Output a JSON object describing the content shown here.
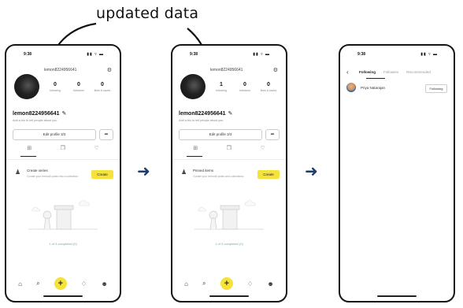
{
  "annotation": {
    "label": "updated data"
  },
  "phone1": {
    "status_time": "9:38",
    "status_icons": "▮▮ ▿ ▬",
    "top_username": "lemon8224956641",
    "stats": [
      {
        "value": "0",
        "label": "following"
      },
      {
        "value": "0",
        "label": "followers"
      },
      {
        "value": "0",
        "label": "likes & saves"
      }
    ],
    "username": "lemon8224956641",
    "bio": "Add a bio to tell people about you",
    "edit_profile": "Edit profile 3/3",
    "card_title": "Create series",
    "card_sub": "Curate your lemon8 posts into a collection",
    "create_label": "Create",
    "completed": "1 of 3 completed (0)"
  },
  "phone2": {
    "status_time": "9:38",
    "status_icons": "▮▮ ▿ ▬",
    "top_username": "lemon8224956641",
    "stats": [
      {
        "value": "1",
        "label": "following"
      },
      {
        "value": "0",
        "label": "followers"
      },
      {
        "value": "0",
        "label": "likes & saves"
      }
    ],
    "username": "lemon8224956641",
    "bio": "Add a bio to tell people about you",
    "edit_profile": "Edit profile 3/3",
    "card_title": "Pinned items",
    "card_sub": "Curate your lemon8 posts and collections",
    "create_label": "Create",
    "completed": "1 of 3 completed (0)"
  },
  "phone3": {
    "status_time": "9:38",
    "status_icons": "▮▮ ▿ ▬",
    "tabs": [
      "Following",
      "Followers",
      "Recommended"
    ],
    "row_name": "Priya Natarajan",
    "row_button": "Following"
  },
  "icons": {
    "back": "‹",
    "gear": "⚙",
    "pen": "✎",
    "share": "➦",
    "grid": "⊞",
    "bookmark": "❐",
    "heart": "♡",
    "user": "♟",
    "home": "⌂",
    "search": "⌕",
    "plus": "+",
    "bell": "♢",
    "profile": "☻",
    "arrow": "➜"
  },
  "colors": {
    "accent": "#f5e23b",
    "arrow": "#1f3d6b"
  }
}
